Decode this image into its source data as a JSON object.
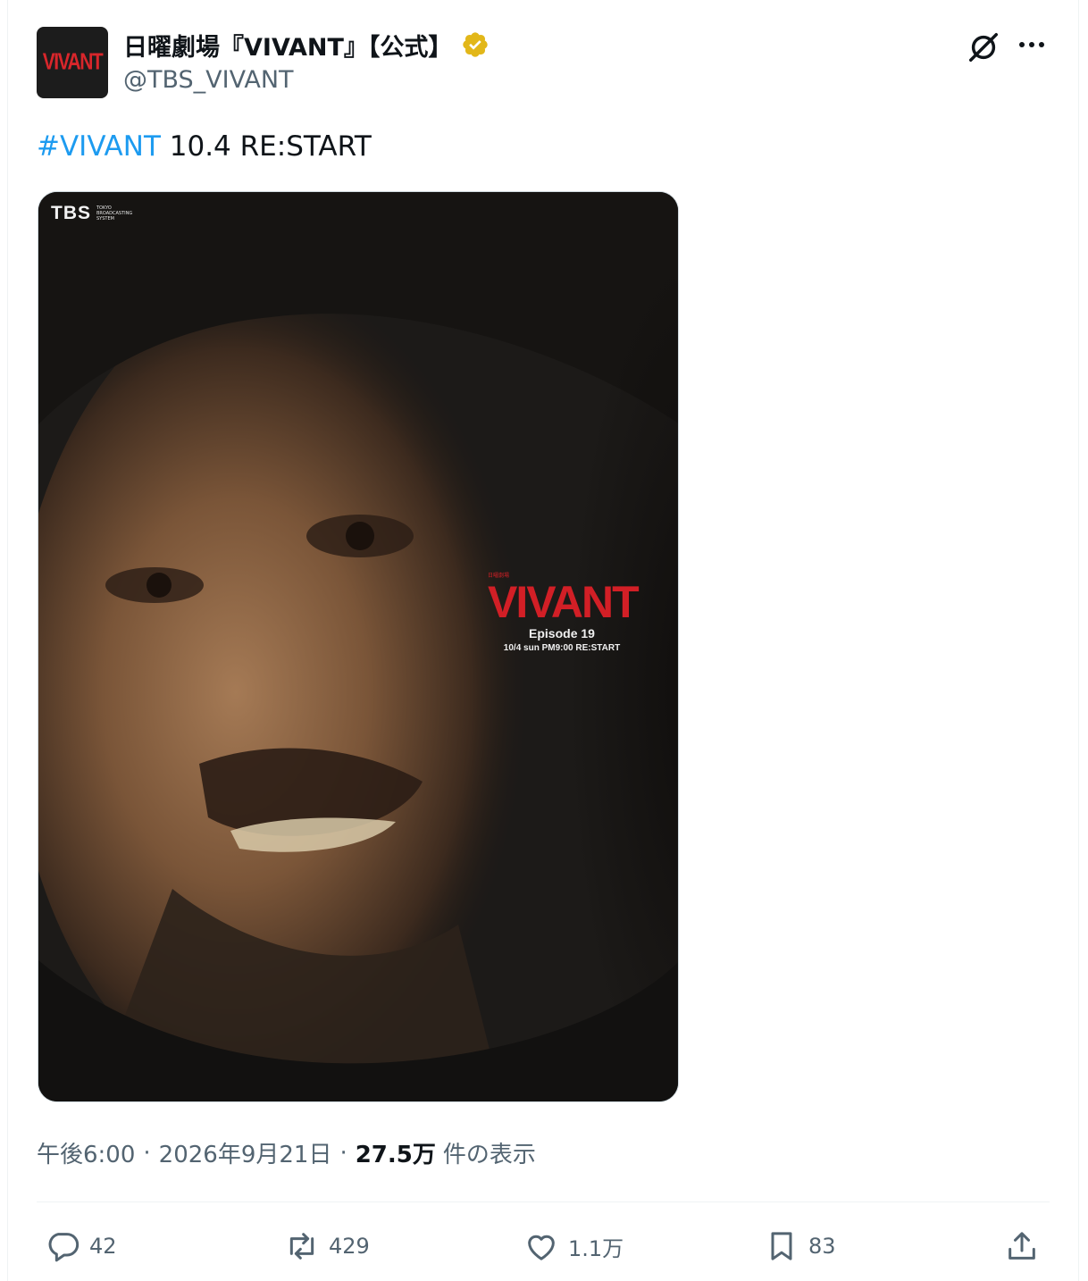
{
  "header": {
    "avatar_logo": "VIVANT",
    "display_name": "日曜劇場『VIVANT』【公式】",
    "handle": "@TBS_VIVANT"
  },
  "tweet": {
    "hashtag": "#VIVANT",
    "text": " 10.4 RE:START"
  },
  "media": {
    "network_logo": "TBS",
    "network_subtitle": "TOKYO BROADCASTING SYSTEM",
    "poster_kicker": "日曜劇場",
    "poster_title": "VIVANT",
    "poster_episode": "Episode 19",
    "poster_date": "10/4 sun PM9:00 RE:START"
  },
  "meta": {
    "time": "午後6:00",
    "separator": "·",
    "date": "2026年9月21日",
    "views_count": "27.5万",
    "views_label": "件の表示"
  },
  "actions": {
    "replies": "42",
    "reposts": "429",
    "likes": "1.1万",
    "bookmarks": "83"
  },
  "icons": {
    "verified": "verified-badge-icon",
    "grok": "grok-icon",
    "more": "more-icon",
    "reply": "reply-icon",
    "repost": "repost-icon",
    "like": "heart-icon",
    "bookmark": "bookmark-icon",
    "share": "share-icon"
  },
  "colors": {
    "hashtag": "#1d9bf0",
    "secondary_text": "#536471",
    "poster_red": "#d21f26",
    "verified_gold": "#e2b719"
  }
}
